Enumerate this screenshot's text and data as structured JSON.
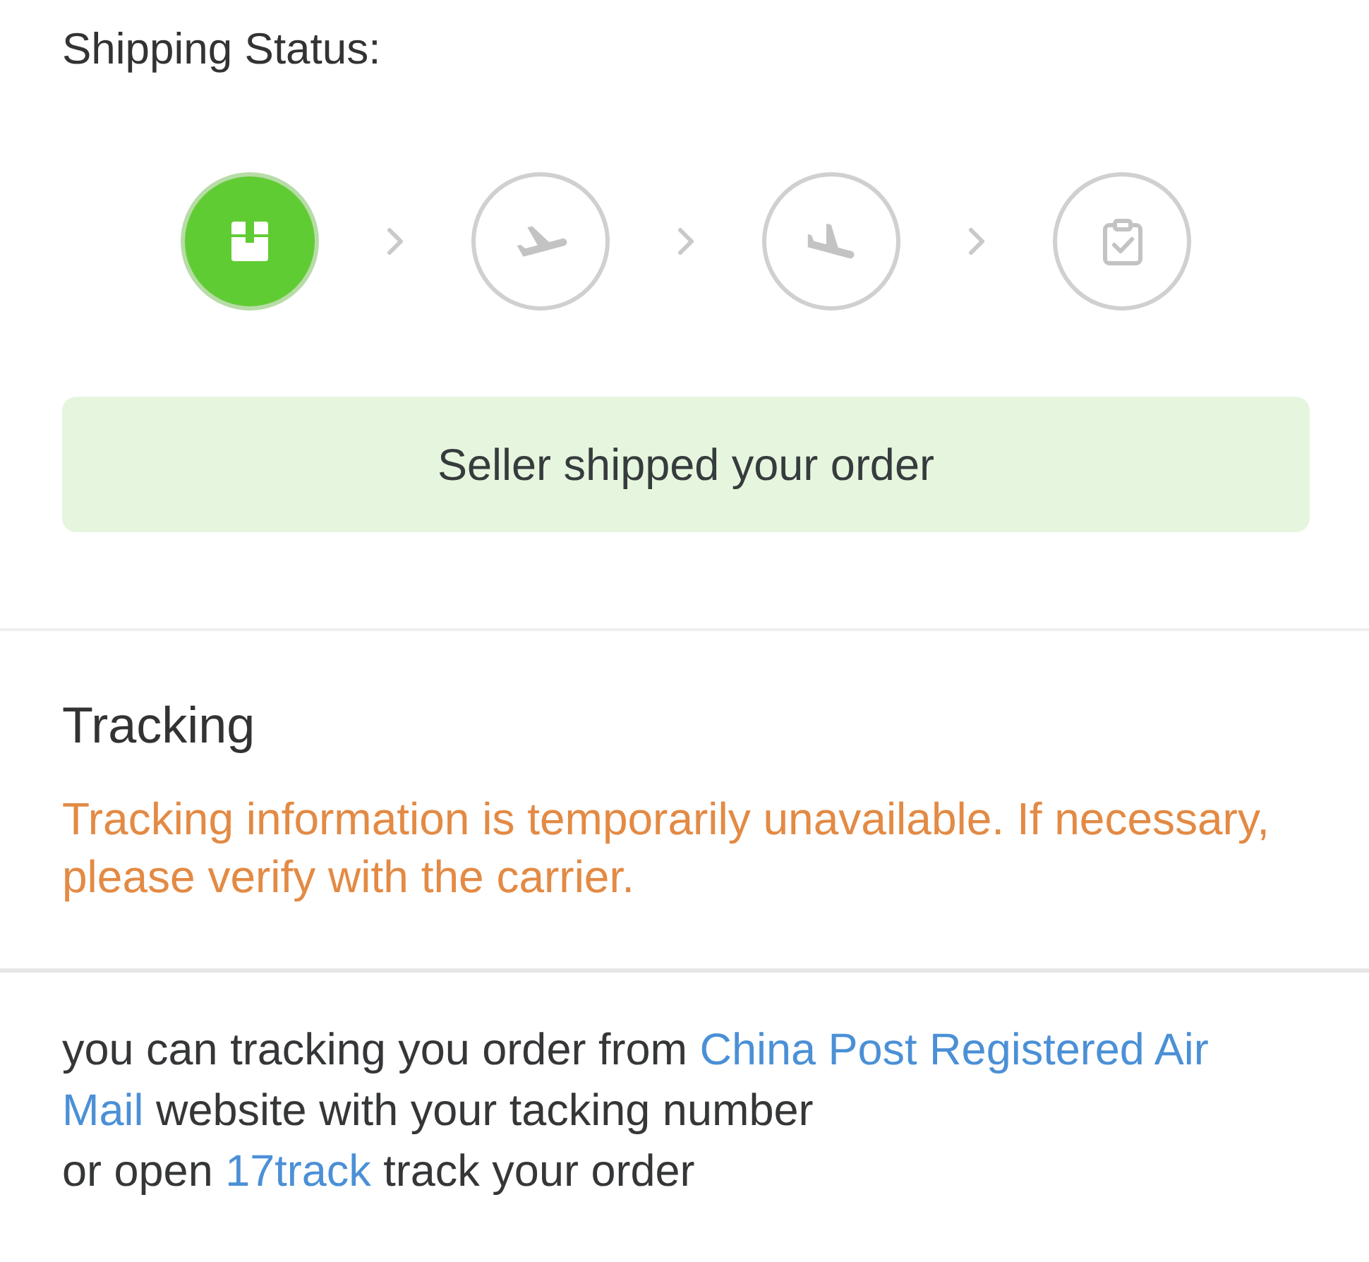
{
  "shipping_status": {
    "title": "Shipping Status:",
    "steps": [
      {
        "kind": "packed",
        "active": true
      },
      {
        "kind": "departed",
        "active": false
      },
      {
        "kind": "arrived",
        "active": false
      },
      {
        "kind": "delivered",
        "active": false
      }
    ],
    "message": "Seller shipped your order"
  },
  "tracking": {
    "title": "Tracking",
    "notice": "Tracking information is temporarily unavailable. If necessary, please verify with the carrier."
  },
  "help_text": {
    "segments": [
      {
        "kind": "text",
        "text": "you can tracking you order from "
      },
      {
        "kind": "link",
        "text": "China Post Registered Air"
      },
      {
        "kind": "break"
      },
      {
        "kind": "link",
        "text": "Mail"
      },
      {
        "kind": "text",
        "text": " website with your tacking number"
      },
      {
        "kind": "break"
      },
      {
        "kind": "text",
        "text": "or open "
      },
      {
        "kind": "link",
        "text": "17track"
      },
      {
        "kind": "text",
        "text": " track your order"
      }
    ]
  }
}
